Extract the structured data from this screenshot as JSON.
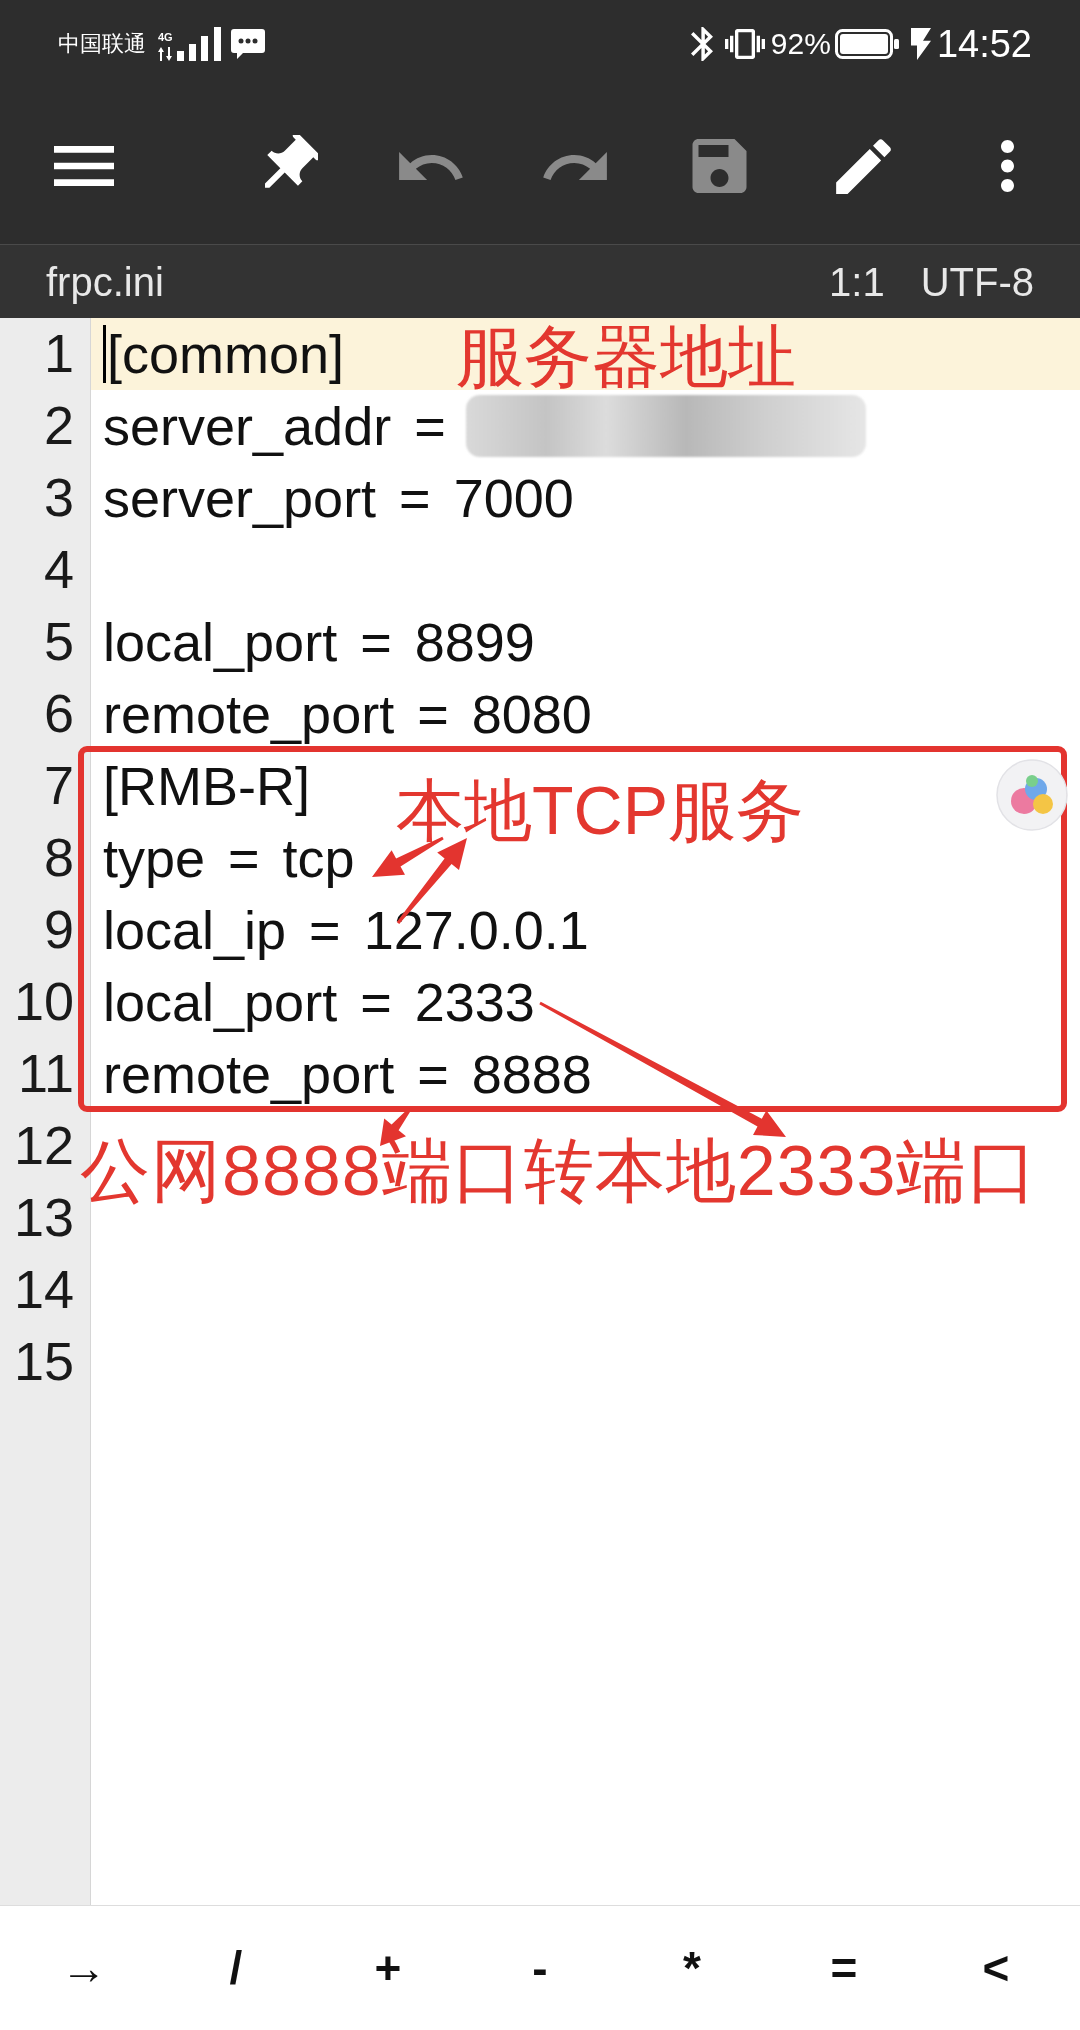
{
  "status_bar": {
    "carrier": "中国联通",
    "network": "4G",
    "battery": "92%",
    "time": "14:52"
  },
  "toolbar": [
    {
      "kind": "menu",
      "disabled": false
    },
    {
      "kind": "pin",
      "disabled": false
    },
    {
      "kind": "undo",
      "disabled": true
    },
    {
      "kind": "redo",
      "disabled": true
    },
    {
      "kind": "save",
      "disabled": true
    },
    {
      "kind": "edit",
      "disabled": false
    },
    {
      "kind": "more",
      "disabled": false
    }
  ],
  "file_bar": {
    "filename": "frpc.ini",
    "position": "1:1",
    "encoding": "UTF-8"
  },
  "editor": {
    "lines": [
      {
        "number": "1",
        "text": "[common]",
        "current": true,
        "redacted": false
      },
      {
        "number": "2",
        "text": "server_addr =",
        "current": false,
        "redacted": true
      },
      {
        "number": "3",
        "text": "server_port = 7000",
        "current": false,
        "redacted": false
      },
      {
        "number": "4",
        "current": false,
        "redacted": false
      },
      {
        "number": "5",
        "text": "local_port = 8899",
        "current": false,
        "redacted": false
      },
      {
        "number": "6",
        "text": "remote_port = 8080",
        "current": false,
        "redacted": false
      },
      {
        "number": "7",
        "text": "[RMB-R]",
        "current": false,
        "redacted": false
      },
      {
        "number": "8",
        "text": "type = tcp",
        "current": false,
        "redacted": false
      },
      {
        "number": "9",
        "text": "local_ip = 127.0.0.1",
        "current": false,
        "redacted": false
      },
      {
        "number": "10",
        "text": "local_port = 2333",
        "current": false,
        "redacted": false
      },
      {
        "number": "11",
        "text": "remote_port = 8888",
        "current": false,
        "redacted": false
      },
      {
        "number": "12",
        "current": false,
        "redacted": false
      },
      {
        "number": "13",
        "current": false,
        "redacted": false
      },
      {
        "number": "14",
        "current": false,
        "redacted": false
      },
      {
        "number": "15",
        "current": false,
        "redacted": false
      }
    ]
  },
  "annotations": [
    {
      "text": "服务器地址"
    },
    {
      "text": "本地TCP服务"
    },
    {
      "text": "公网8888端口转本地2333端口"
    }
  ],
  "keys": [
    "→",
    "/",
    "+",
    "-",
    "*",
    "=",
    "<"
  ]
}
